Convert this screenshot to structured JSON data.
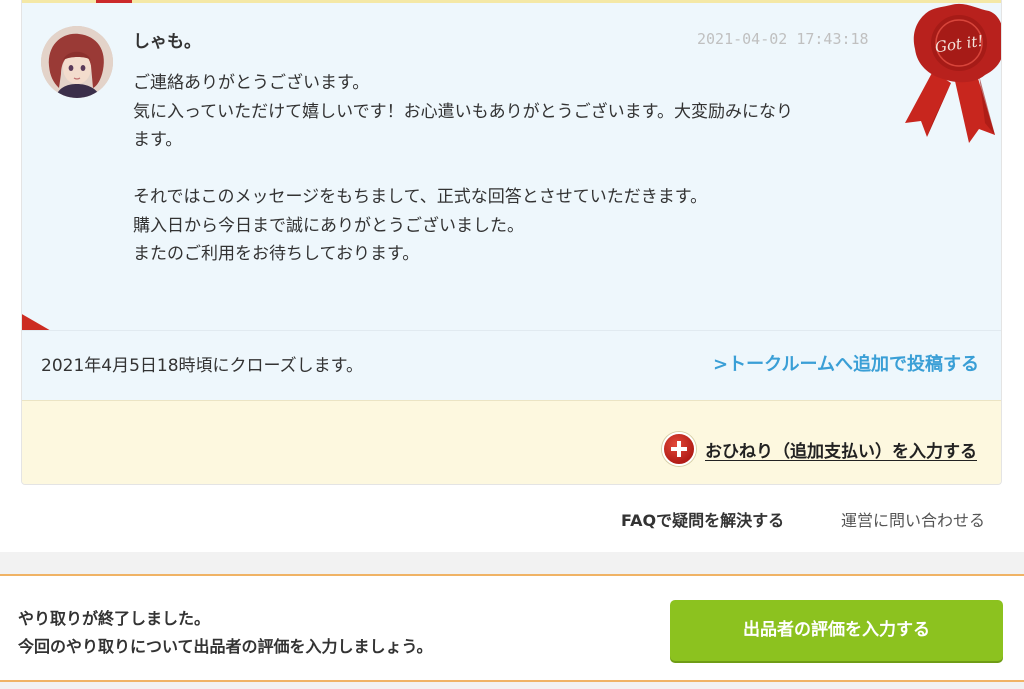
{
  "message": {
    "sender": "しゃも。",
    "timestamp": "2021-04-02 17:43:18",
    "lines": [
      "ご連絡ありがとうございます。",
      "気に入っていただけて嬉しいです！お心遣いもありがとうございます。大変励みになり",
      "ます。",
      "",
      "それではこのメッセージをもちまして、正式な回答とさせていただきます。",
      "購入日から今日まで誠にありがとうございました。",
      "またのご利用をお待ちしております。"
    ],
    "seal_text": "Got it!"
  },
  "close_row": {
    "notice": "2021年4月5日18時頃にクローズします。",
    "talk_link": ">トークルームへ追加で投稿する"
  },
  "tip_row": {
    "label": "おひねり（追加支払い）を入力する",
    "icon": "plus-circle-icon"
  },
  "help_links": {
    "faq": "FAQで疑問を解決する",
    "contact": "運営に問い合わせる"
  },
  "completion": {
    "line1": "やり取りが終了しました。",
    "line2": "今回のやり取りについて出品者の評価を入力しましょう。",
    "button": "出品者の評価を入力する"
  },
  "colors": {
    "link_blue": "#3a9fd6",
    "button_green": "#8cc21f",
    "accent_orange": "#f0b365",
    "seal_red": "#b8211d"
  }
}
